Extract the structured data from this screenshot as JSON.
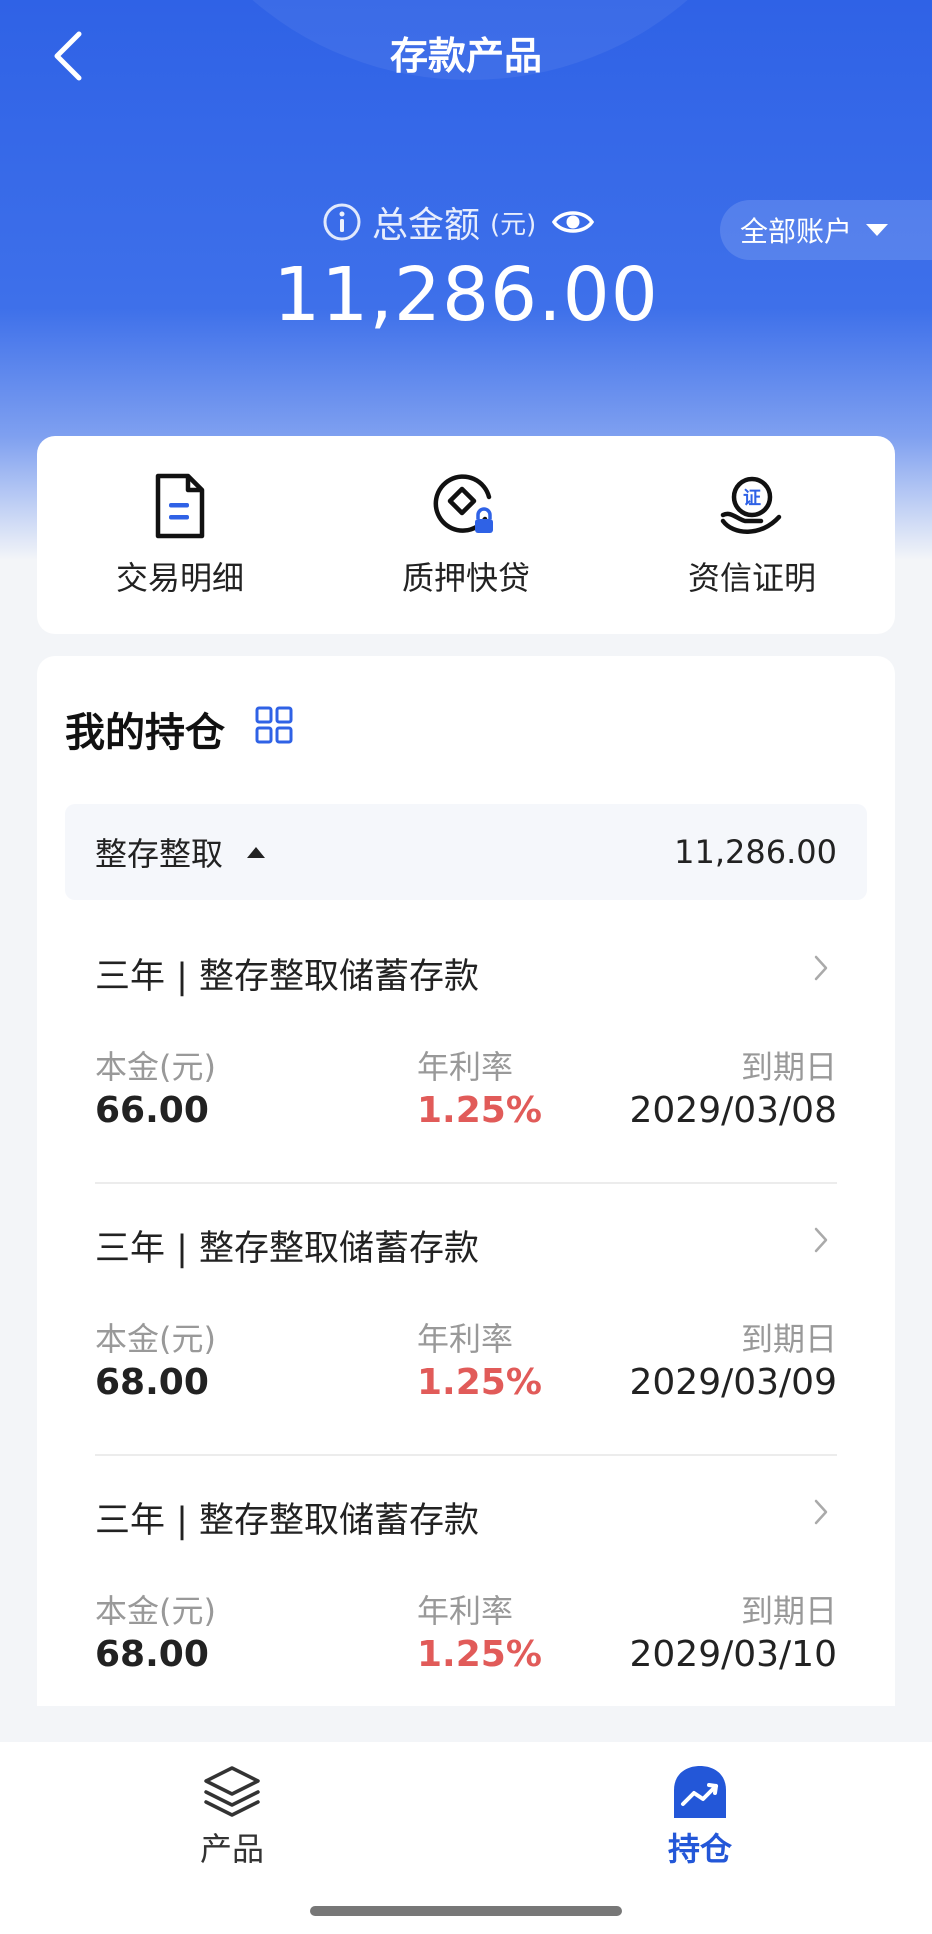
{
  "nav": {
    "title": "存款产品"
  },
  "summary": {
    "total_label": "总金额",
    "unit": "(元)",
    "total_amount": "11,286.00",
    "account_selector": "全部账户"
  },
  "quick_actions": [
    {
      "label": "交易明细",
      "icon": "document-icon"
    },
    {
      "label": "质押快贷",
      "icon": "pledge-loan-icon"
    },
    {
      "label": "资信证明",
      "icon": "credit-certificate-icon"
    }
  ],
  "holdings": {
    "title": "我的持仓",
    "group": {
      "name": "整存整取",
      "amount": "11,286.00"
    },
    "columns": {
      "principal": "本金(元)",
      "rate": "年利率",
      "maturity": "到期日"
    },
    "items": [
      {
        "name": "三年 | 整存整取储蓄存款",
        "principal": "66.00",
        "rate": "1.25%",
        "maturity": "2029/03/08"
      },
      {
        "name": "三年 | 整存整取储蓄存款",
        "principal": "68.00",
        "rate": "1.25%",
        "maturity": "2029/03/09"
      },
      {
        "name": "三年 | 整存整取储蓄存款",
        "principal": "68.00",
        "rate": "1.25%",
        "maturity": "2029/03/10"
      }
    ]
  },
  "tabbar": {
    "products": "产品",
    "holdings": "持仓"
  },
  "colors": {
    "primary": "#2f62e6",
    "rate": "#e15b59",
    "active_tab": "#2357d8"
  }
}
